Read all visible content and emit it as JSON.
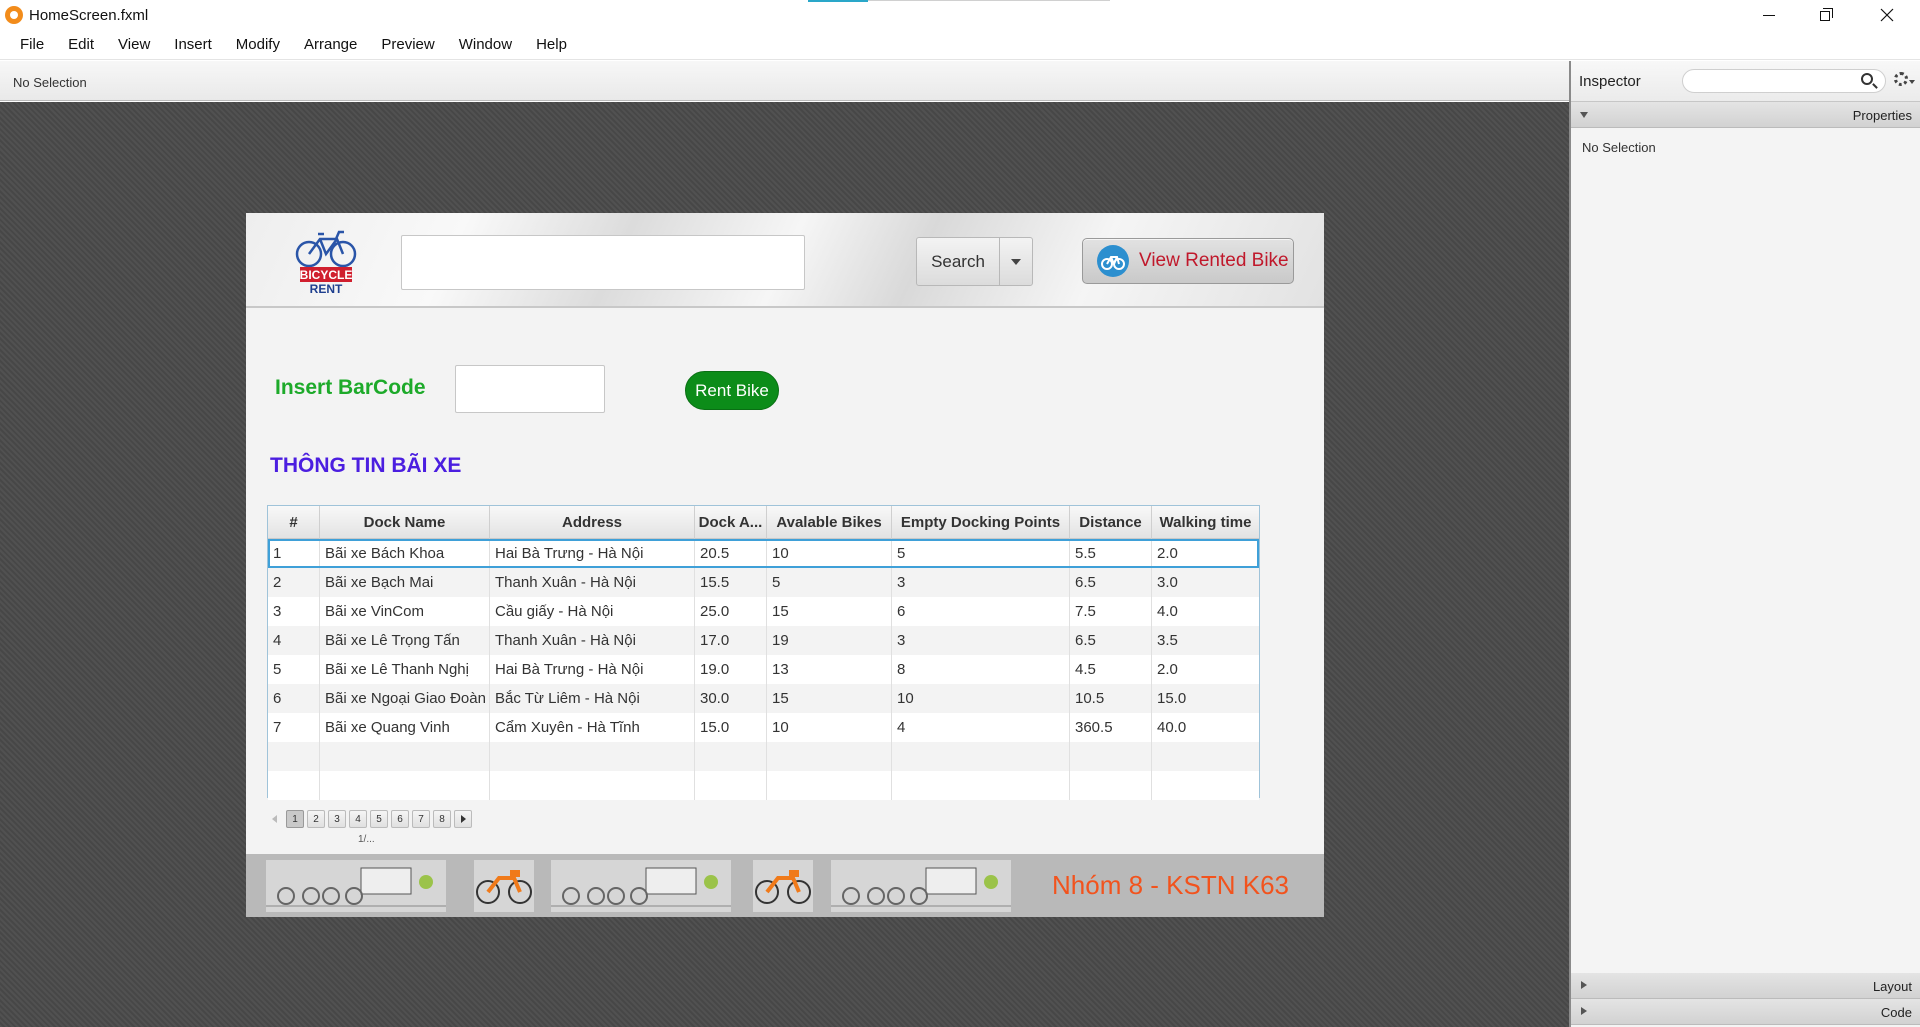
{
  "window": {
    "title": "HomeScreen.fxml"
  },
  "menu": [
    "File",
    "Edit",
    "View",
    "Insert",
    "Modify",
    "Arrange",
    "Preview",
    "Window",
    "Help"
  ],
  "hierarchy_bar": {
    "status": "No Selection"
  },
  "inspector": {
    "title": "Inspector",
    "properties_label": "Properties",
    "no_selection": "No Selection",
    "layout_label": "Layout",
    "code_label": "Code"
  },
  "scene": {
    "logo": {
      "line1": "BICYCLE",
      "line2": "RENT"
    },
    "search_button": "Search",
    "view_rented_button": "View Rented Bike",
    "barcode_label": "Insert BarCode",
    "rent_button": "Rent Bike",
    "section_title": "THÔNG TIN BÃI XE",
    "table": {
      "columns": [
        "#",
        "Dock Name",
        "Address",
        "Dock A...",
        "Avalable Bikes",
        "Empty Docking Points",
        "Distance",
        "Walking time"
      ],
      "rows": [
        [
          "1",
          "Bãi xe Bách Khoa",
          "Hai Bà Trưng - Hà Nội",
          "20.5",
          "10",
          "5",
          "5.5",
          "2.0"
        ],
        [
          "2",
          "Bãi xe Bạch Mai",
          "Thanh Xuân - Hà Nội",
          "15.5",
          "5",
          "3",
          "6.5",
          "3.0"
        ],
        [
          "3",
          "Bãi xe VinCom",
          "Cầu giấy - Hà Nội",
          "25.0",
          "15",
          "6",
          "7.5",
          "4.0"
        ],
        [
          "4",
          "Bãi xe Lê Trọng Tấn",
          "Thanh Xuân - Hà Nội",
          "17.0",
          "19",
          "3",
          "6.5",
          "3.5"
        ],
        [
          "5",
          "Bãi xe Lê Thanh Nghị",
          "Hai Bà Trưng - Hà Nội",
          "19.0",
          "13",
          "8",
          "4.5",
          "2.0"
        ],
        [
          "6",
          "Bãi xe Ngoại Giao Đoàn",
          "Bắc Từ Liêm - Hà Nội",
          "30.0",
          "15",
          "10",
          "10.5",
          "15.0"
        ],
        [
          "7",
          "Bãi xe Quang Vinh",
          "Cẩm Xuyên - Hà Tĩnh",
          "15.0",
          "10",
          "4",
          "360.5",
          "40.0"
        ]
      ],
      "selected_row": 1
    },
    "pagination": {
      "pages": [
        "1",
        "2",
        "3",
        "4",
        "5",
        "6",
        "7",
        "8"
      ],
      "current": "1",
      "info": "1/..."
    },
    "footer_text": "Nhóm 8 - KSTN K63"
  }
}
